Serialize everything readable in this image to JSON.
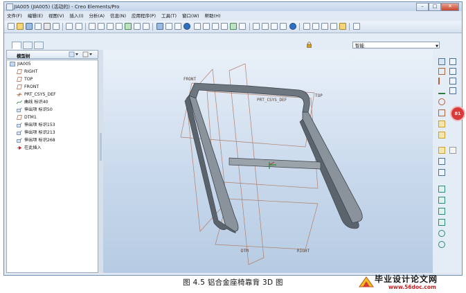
{
  "window": {
    "title": "JIA005 (JIA005) (活动的) - Creo Elements/Pro",
    "controls": {
      "minimize": "–",
      "maximize": "□",
      "close": "✕"
    }
  },
  "menu": [
    {
      "label": "文件(F)"
    },
    {
      "label": "编辑(E)"
    },
    {
      "label": "视图(V)"
    },
    {
      "label": "插入(I)"
    },
    {
      "label": "分析(A)"
    },
    {
      "label": "信息(N)"
    },
    {
      "label": "应用程序(P)"
    },
    {
      "label": "工具(T)"
    },
    {
      "label": "窗口(W)"
    },
    {
      "label": "帮助(H)"
    }
  ],
  "filter": {
    "selected": "智能"
  },
  "model_tree": {
    "title": "模型树",
    "items": [
      {
        "label": "JIA005",
        "icon": "part-icon"
      },
      {
        "label": "RIGHT",
        "icon": "datum-plane-icon"
      },
      {
        "label": "TOP",
        "icon": "datum-plane-icon"
      },
      {
        "label": "FRONT",
        "icon": "datum-plane-icon"
      },
      {
        "label": "PRT_CSYS_DEF",
        "icon": "csys-icon"
      },
      {
        "label": "曲线 标识40",
        "icon": "curve-icon"
      },
      {
        "label": "伸出项 标识50",
        "icon": "extrude-icon"
      },
      {
        "label": "DTM1",
        "icon": "datum-plane-icon"
      },
      {
        "label": "伸出项 标识153",
        "icon": "extrude-icon"
      },
      {
        "label": "伸出项 标识213",
        "icon": "extrude-icon"
      },
      {
        "label": "伸出项 标识268",
        "icon": "extrude-icon"
      },
      {
        "label": "在此插入",
        "icon": "insert-here-icon"
      }
    ]
  },
  "viewport": {
    "labels": {
      "front": "FRONT",
      "top": "TOP",
      "csys": "PRT_CSYS_DEF",
      "dtm": "DTM",
      "right": "RIGHT"
    }
  },
  "badge": {
    "text": "81"
  },
  "caption": "图 4.5 铝合金座椅靠背 3D 图",
  "watermark": {
    "title": "毕业设计论文网",
    "url": "www.56doc.com"
  },
  "colors": {
    "accent": "#2f6fc0",
    "badge": "#d83a3a",
    "plane": "#b07f6a",
    "model": "#6d757e"
  }
}
